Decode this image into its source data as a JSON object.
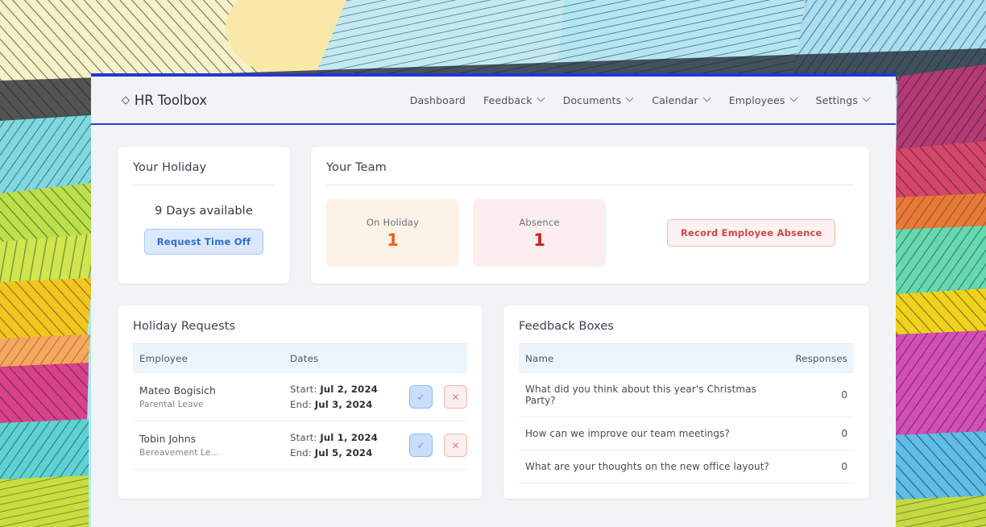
{
  "app": {
    "brand_icon": "diamond-icon",
    "brand_name": "HR Toolbox",
    "accent_color": "#2335d6"
  },
  "nav": {
    "items": [
      {
        "label": "Dashboard",
        "has_dropdown": false
      },
      {
        "label": "Feedback",
        "has_dropdown": true
      },
      {
        "label": "Documents",
        "has_dropdown": true
      },
      {
        "label": "Calendar",
        "has_dropdown": true
      },
      {
        "label": "Employees",
        "has_dropdown": true
      },
      {
        "label": "Settings",
        "has_dropdown": true
      }
    ]
  },
  "holiday_card": {
    "title": "Your Holiday",
    "days_available": "9 Days available",
    "request_button": "Request Time Off"
  },
  "team_card": {
    "title": "Your Team",
    "stats": [
      {
        "label": "On Holiday",
        "value": "1",
        "bg": "#fdf2e6",
        "color": "#ec6312"
      },
      {
        "label": "Absence",
        "value": "1",
        "bg": "#fceeee",
        "color": "#cf2020"
      }
    ],
    "record_absence_button": "Record Employee Absence"
  },
  "holiday_requests": {
    "title": "Holiday Requests",
    "columns": [
      "Employee",
      "Dates"
    ],
    "rows": [
      {
        "employee": "Mateo Bogisich",
        "leave_type": "Parental Leave",
        "start_label": "Start:",
        "start_date": "Jul 2, 2024",
        "end_label": "End:",
        "end_date": "Jul 3, 2024",
        "approve_icon": "check-icon",
        "reject_icon": "cross-icon"
      },
      {
        "employee": "Tobin Johns",
        "leave_type": "Bereavement Le...",
        "start_label": "Start:",
        "start_date": "Jul 1, 2024",
        "end_label": "End:",
        "end_date": "Jul 5, 2024",
        "approve_icon": "check-icon",
        "reject_icon": "cross-icon"
      }
    ]
  },
  "feedback_boxes": {
    "title": "Feedback Boxes",
    "columns": [
      "Name",
      "Responses"
    ],
    "rows": [
      {
        "name": "What did you think about this year's Christmas Party?",
        "responses": "0"
      },
      {
        "name": "How can we improve our team meetings?",
        "responses": "0"
      },
      {
        "name": "What are your thoughts on the new office layout?",
        "responses": "0"
      }
    ]
  }
}
